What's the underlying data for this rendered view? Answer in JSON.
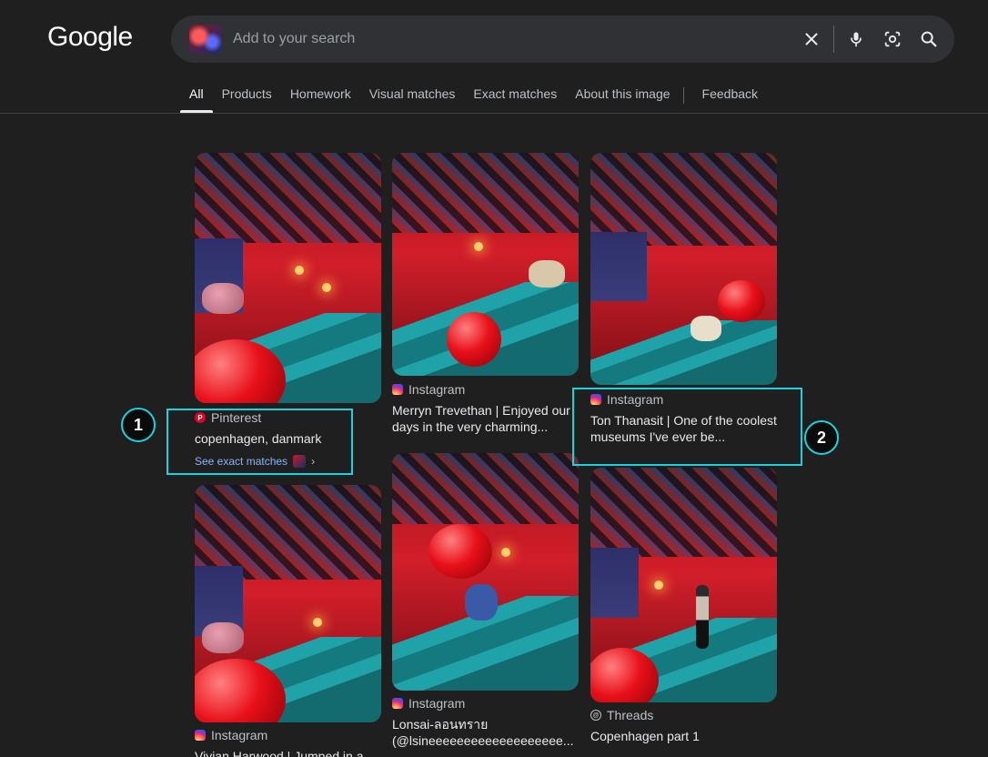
{
  "logo": "Google",
  "search": {
    "placeholder": "Add to your search"
  },
  "tabs": [
    {
      "label": "All",
      "active": true
    },
    {
      "label": "Products"
    },
    {
      "label": "Homework"
    },
    {
      "label": "Visual matches"
    },
    {
      "label": "Exact matches"
    },
    {
      "label": "About this image"
    },
    {
      "label": "Feedback"
    }
  ],
  "cards": [
    {
      "source": "Pinterest",
      "source_icon": "pinterest-icon",
      "title": "copenhagen, danmark",
      "exact_label": "See exact matches"
    },
    {
      "source": "Instagram",
      "source_icon": "instagram-icon",
      "title": "Merryn Trevethan | Enjoyed our days in the very charming..."
    },
    {
      "source": "Instagram",
      "source_icon": "instagram-icon",
      "title": "Ton Thanasit | One of the coolest museums I've ever be..."
    },
    {
      "source": "Instagram",
      "source_icon": "instagram-icon",
      "title": "Vivian Harwood | Jumped in a"
    },
    {
      "source": "Instagram",
      "source_icon": "instagram-icon",
      "title": "Lonsai-ลอนทราย (@lsineeeeeeeeeeeeeeeeeee..."
    },
    {
      "source": "Threads",
      "source_icon": "threads-icon",
      "title": "Copenhagen part 1"
    }
  ],
  "annotations": [
    "1",
    "2"
  ],
  "colors": {
    "background": "#1f1f1f",
    "highlight": "#18d3e0",
    "link": "#8ab4f8"
  }
}
